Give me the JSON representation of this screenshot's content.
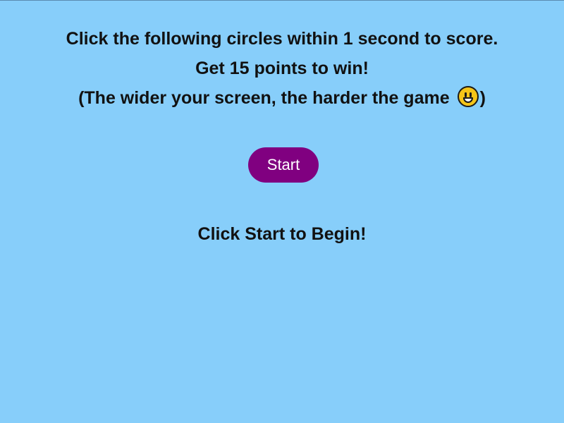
{
  "colors": {
    "background": "#87cefa",
    "start_button": "#800080",
    "start_button_text": "#ffffff",
    "text": "#111111"
  },
  "instructions": {
    "line1": "Click the following circles within 1 second to score.",
    "line2": "Get 15 points to win!",
    "line3_prefix": "(The wider your screen, the harder the game",
    "line3_emoji": "grinning-face-icon",
    "line3_suffix": ")"
  },
  "start_button": {
    "label": "Start"
  },
  "status": {
    "message": "Click Start to Begin!"
  }
}
